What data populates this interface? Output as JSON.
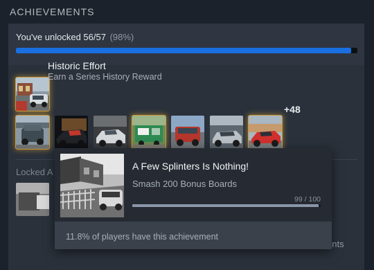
{
  "section": {
    "title": "ACHIEVEMENTS"
  },
  "progress": {
    "text": "You've unlocked 56/57",
    "percent_text": "(98%)",
    "fraction": 0.982
  },
  "featured": {
    "title": "Historic Effort",
    "description": "Earn a Series History Reward"
  },
  "unlocked_more": "+48",
  "locked": {
    "label": "Locked A",
    "partial_text": "ents"
  },
  "tooltip": {
    "title": "A Few Splinters Is Nothing!",
    "description": "Smash 200 Bonus Boards",
    "progress_text": "99 / 100",
    "progress_fraction": 0.99,
    "rarity": "11.8% of players have this achievement"
  },
  "colors": {
    "accent": "#1a6fe0",
    "gold_glow": "#c89a3a",
    "background": "#1c222c"
  }
}
